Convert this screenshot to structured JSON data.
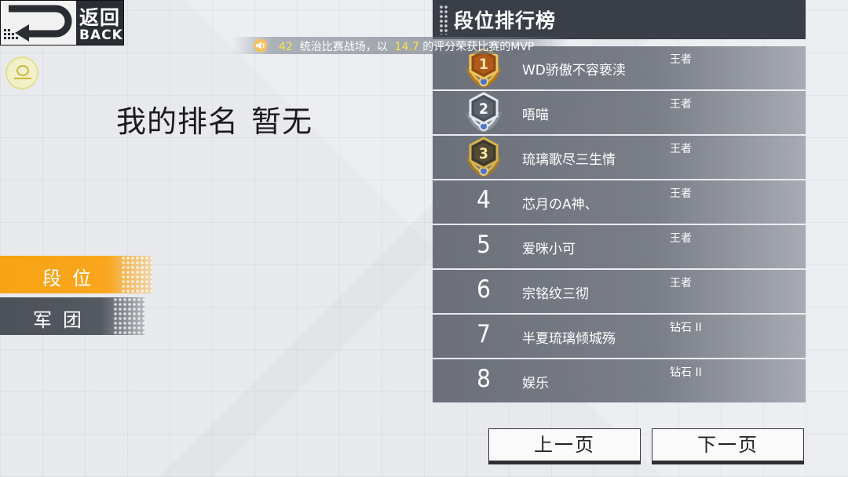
{
  "back": {
    "zh_label": "返回",
    "en_label": "BACK"
  },
  "my_rank": {
    "label": "我的排名",
    "value": "暂无"
  },
  "tabs": [
    {
      "label": "段位",
      "active": true
    },
    {
      "label": "军团",
      "active": false
    }
  ],
  "ticker": {
    "count": "42",
    "text_before": "统治比赛战场，以",
    "score": "14.7",
    "text_after": "的评分荣获比赛的MVP"
  },
  "board": {
    "title": "段位排行榜",
    "rows": [
      {
        "rank": "1",
        "name": "WD骄傲不容亵渎",
        "tier": "王者",
        "medal": "gold"
      },
      {
        "rank": "2",
        "name": "唔喵",
        "tier": "王者",
        "medal": "silver"
      },
      {
        "rank": "3",
        "name": "琉璃歌尽三生情",
        "tier": "王者",
        "medal": "bronze"
      },
      {
        "rank": "4",
        "name": "芯月のA神、",
        "tier": "王者"
      },
      {
        "rank": "5",
        "name": "爱咪小可",
        "tier": "王者"
      },
      {
        "rank": "6",
        "name": "宗铭纹三彻",
        "tier": "王者"
      },
      {
        "rank": "7",
        "name": "半夏琉璃倾城殇",
        "tier": "钻石 II"
      },
      {
        "rank": "8",
        "name": "娱乐",
        "tier": "钻石 II"
      }
    ]
  },
  "pager": {
    "prev_label": "上一页",
    "next_label": "下一页"
  },
  "colors": {
    "accent": "#f7a313",
    "header": "#3a3e46",
    "highlight": "#f5e64a"
  }
}
